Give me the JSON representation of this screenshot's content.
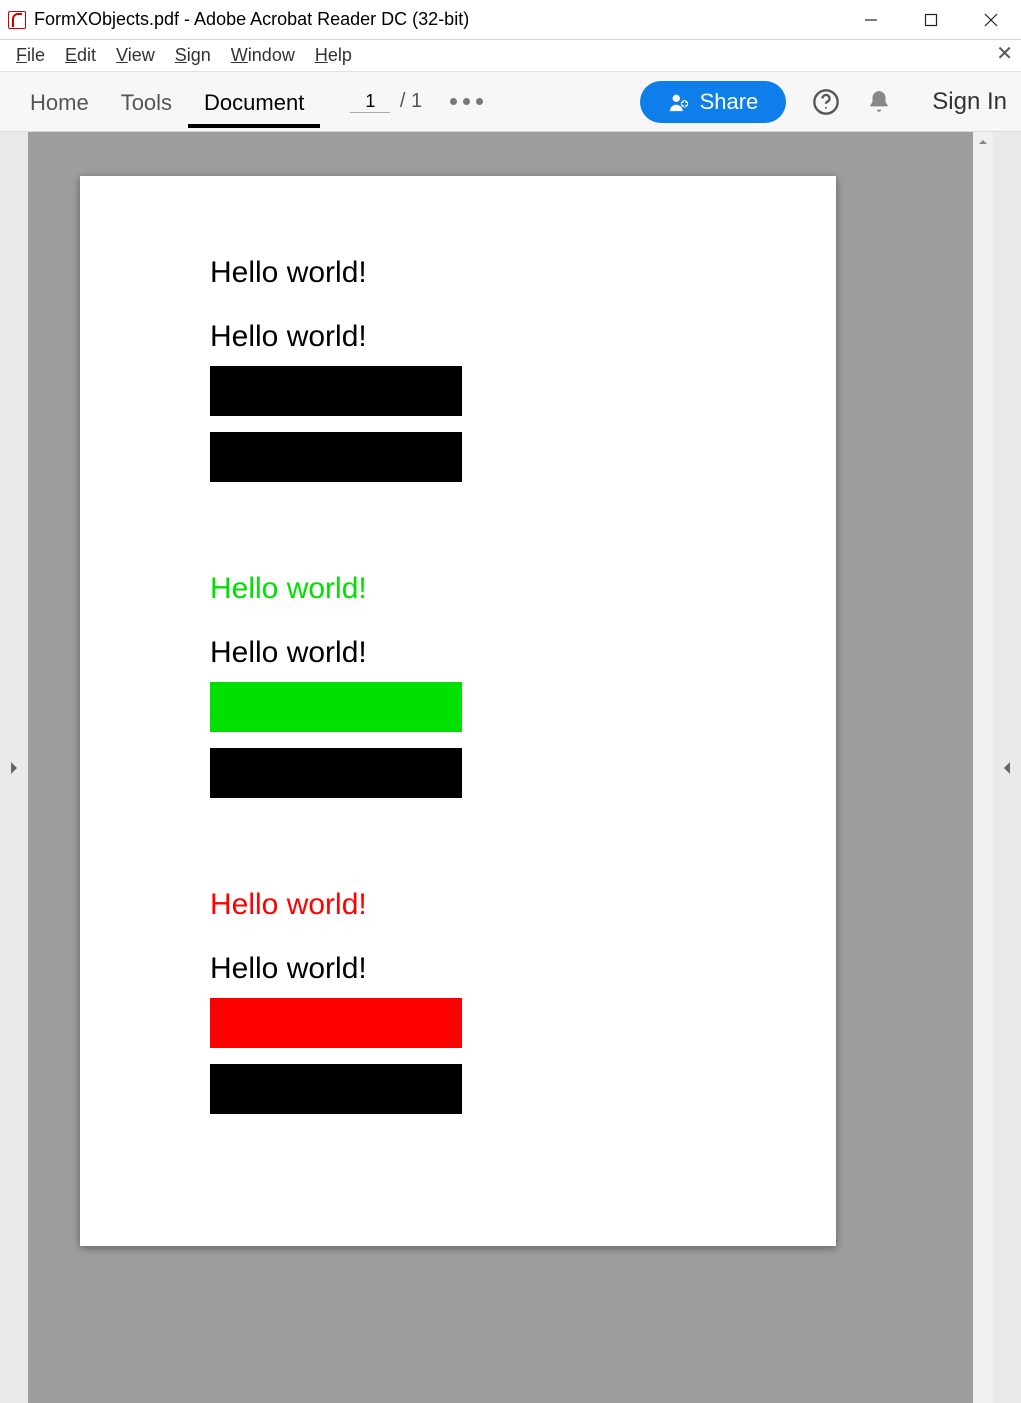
{
  "window": {
    "title": "FormXObjects.pdf - Adobe Acrobat Reader DC (32-bit)"
  },
  "menu": {
    "file": "File",
    "edit": "Edit",
    "view": "View",
    "sign": "Sign",
    "window": "Window",
    "help": "Help"
  },
  "toolbar": {
    "home": "Home",
    "tools": "Tools",
    "document": "Document",
    "page_current": "1",
    "page_total": "1",
    "share": "Share",
    "signin": "Sign In"
  },
  "pdf": {
    "groups": [
      {
        "text1": {
          "value": "Hello world!",
          "color": "#000000"
        },
        "text2": {
          "value": "Hello world!",
          "color": "#000000"
        },
        "rect1_color": "#000000",
        "rect2_color": "#000000"
      },
      {
        "text1": {
          "value": "Hello world!",
          "color": "#00e000"
        },
        "text2": {
          "value": "Hello world!",
          "color": "#000000"
        },
        "rect1_color": "#00e000",
        "rect2_color": "#000000"
      },
      {
        "text1": {
          "value": "Hello world!",
          "color": "#ff0000"
        },
        "text2": {
          "value": "Hello world!",
          "color": "#000000"
        },
        "rect1_color": "#ff0000",
        "rect2_color": "#000000"
      }
    ]
  }
}
